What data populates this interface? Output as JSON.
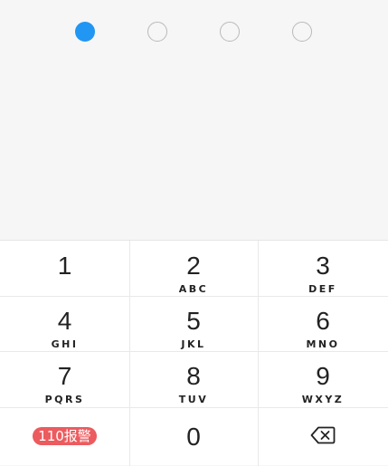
{
  "pin": {
    "length": 4,
    "entered": 1,
    "filled_color": "#2196f3",
    "empty_border_color": "#b9b9b9"
  },
  "keypad": {
    "keys": [
      {
        "digit": "1",
        "letters": ""
      },
      {
        "digit": "2",
        "letters": "ABC"
      },
      {
        "digit": "3",
        "letters": "DEF"
      },
      {
        "digit": "4",
        "letters": "GHI"
      },
      {
        "digit": "5",
        "letters": "JKL"
      },
      {
        "digit": "6",
        "letters": "MNO"
      },
      {
        "digit": "7",
        "letters": "PQRS"
      },
      {
        "digit": "8",
        "letters": "TUV"
      },
      {
        "digit": "9",
        "letters": "WXYZ"
      }
    ],
    "emergency_label": "110报警",
    "emergency_color": "#ec5b5e",
    "zero_digit": "0",
    "backspace_icon": "backspace-icon"
  }
}
